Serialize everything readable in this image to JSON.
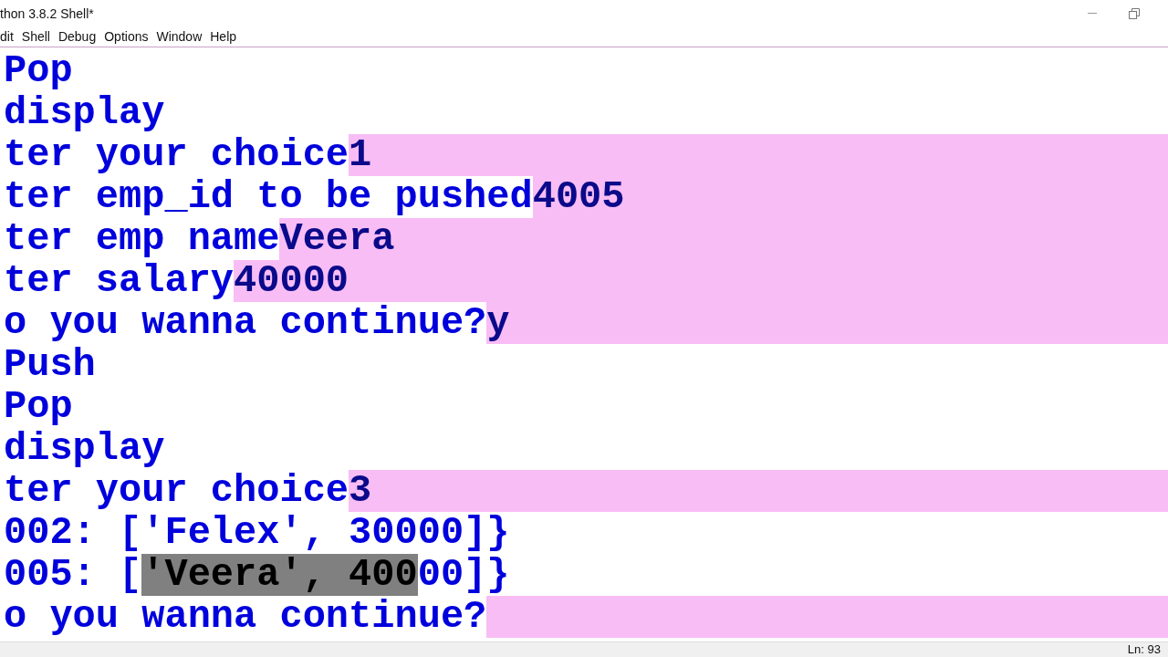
{
  "window": {
    "title": "thon 3.8.2 Shell*"
  },
  "menu": [
    "dit",
    "Shell",
    "Debug",
    "Options",
    "Window",
    "Help"
  ],
  "lines": [
    {
      "kind": "output",
      "segments": [
        {
          "text": "Pop",
          "selected": false
        }
      ]
    },
    {
      "kind": "output",
      "segments": [
        {
          "text": "display",
          "selected": false
        }
      ]
    },
    {
      "kind": "prompt",
      "text": "ter your choice",
      "input": "1"
    },
    {
      "kind": "prompt",
      "text": "ter emp_id to be pushed",
      "input": "4005"
    },
    {
      "kind": "prompt",
      "text": "ter emp name",
      "input": "Veera"
    },
    {
      "kind": "prompt",
      "text": "ter salary",
      "input": "40000"
    },
    {
      "kind": "prompt",
      "text": "o you wanna continue?",
      "input": "y"
    },
    {
      "kind": "output",
      "segments": [
        {
          "text": "Push",
          "selected": false
        }
      ]
    },
    {
      "kind": "output",
      "segments": [
        {
          "text": "Pop",
          "selected": false
        }
      ]
    },
    {
      "kind": "output",
      "segments": [
        {
          "text": "display",
          "selected": false
        }
      ]
    },
    {
      "kind": "prompt",
      "text": "ter your choice",
      "input": "3"
    },
    {
      "kind": "output",
      "segments": [
        {
          "text": "002: ['Felex', 30000]}",
          "selected": false
        }
      ]
    },
    {
      "kind": "output",
      "segments": [
        {
          "text": "005: [",
          "selected": false
        },
        {
          "text": "'Veera', 400",
          "selected": true
        },
        {
          "text": "00]}",
          "selected": false
        }
      ]
    },
    {
      "kind": "prompt",
      "text": "o you wanna continue?"
    }
  ],
  "status_bar": {
    "position": "Ln: 93"
  }
}
